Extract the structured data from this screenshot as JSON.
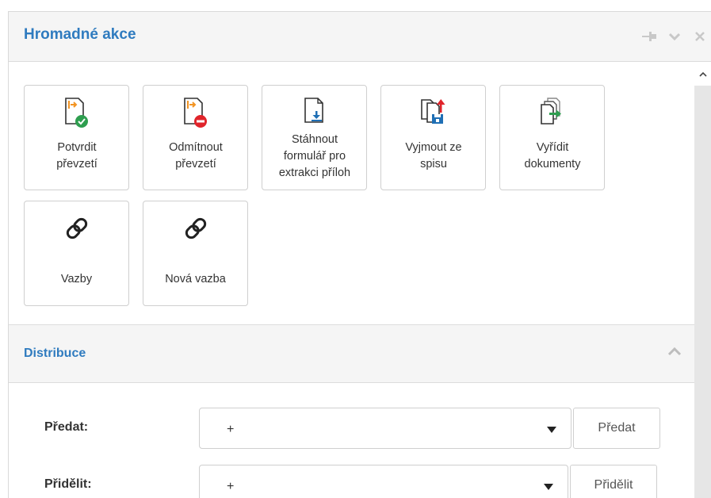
{
  "panel": {
    "title": "Hromadné akce",
    "tools": [
      "pin-icon",
      "chevron-down-icon",
      "close-icon"
    ]
  },
  "actions": [
    {
      "label": "Potvrdit převzetí",
      "icon": "confirm-receipt-icon"
    },
    {
      "label": "Odmítnout převzetí",
      "icon": "reject-receipt-icon"
    },
    {
      "label": "Stáhnout formulář pro extrakci příloh",
      "icon": "download-form-icon"
    },
    {
      "label": "Vyjmout ze spisu",
      "icon": "remove-from-file-icon"
    },
    {
      "label": "Vyřídit dokumenty",
      "icon": "settle-documents-icon"
    },
    {
      "label": "Vazby",
      "icon": "link-icon"
    },
    {
      "label": "Nová vazba",
      "icon": "new-link-icon"
    }
  ],
  "distribution": {
    "title": "Distribuce",
    "rows": [
      {
        "label": "Předat:",
        "value": "+",
        "button": "Předat"
      },
      {
        "label": "Přidělit:",
        "value": "+",
        "button": "Přidělit"
      }
    ]
  },
  "colors": {
    "accent": "#2f7bbf",
    "orange": "#f29423",
    "green": "#2e9e4f",
    "red": "#e0242b",
    "blue": "#1f6fb5"
  }
}
